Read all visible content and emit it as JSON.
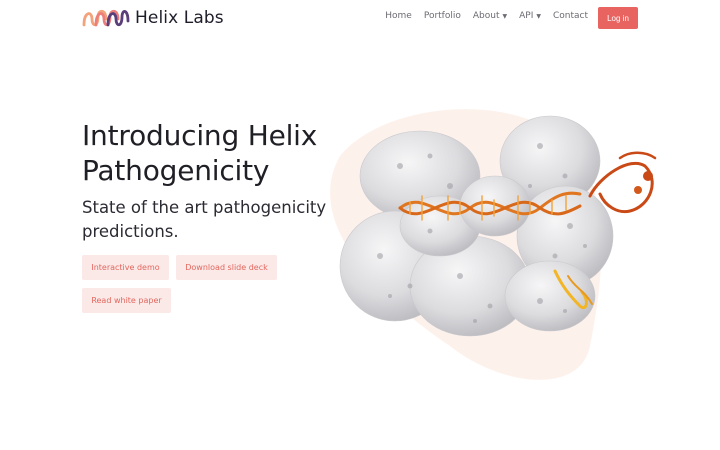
{
  "brand": {
    "name": "Helix Labs",
    "logo_icon": "helix-logo-icon"
  },
  "nav": {
    "items": [
      {
        "label": "Home",
        "dropdown": false
      },
      {
        "label": "Portfolio",
        "dropdown": false
      },
      {
        "label": "About",
        "dropdown": true
      },
      {
        "label": "API",
        "dropdown": true
      },
      {
        "label": "Contact",
        "dropdown": false
      }
    ],
    "login_label": "Log in"
  },
  "hero": {
    "title": "Introducing Helix Pathogenicity",
    "subtitle": "State of the art pathogenicity predictions.",
    "buttons": {
      "demo": "Interactive demo",
      "deck": "Download slide deck",
      "paper": "Read white paper"
    },
    "illustration": "protein-dna-complex-illustration"
  },
  "colors": {
    "accent": "#e86461",
    "soft_button_bg": "#fbe9e7",
    "soft_button_text": "#e2675f",
    "blob": "#fdf1ec",
    "protein": "#e4e4e6",
    "dna": "#e0761f"
  }
}
